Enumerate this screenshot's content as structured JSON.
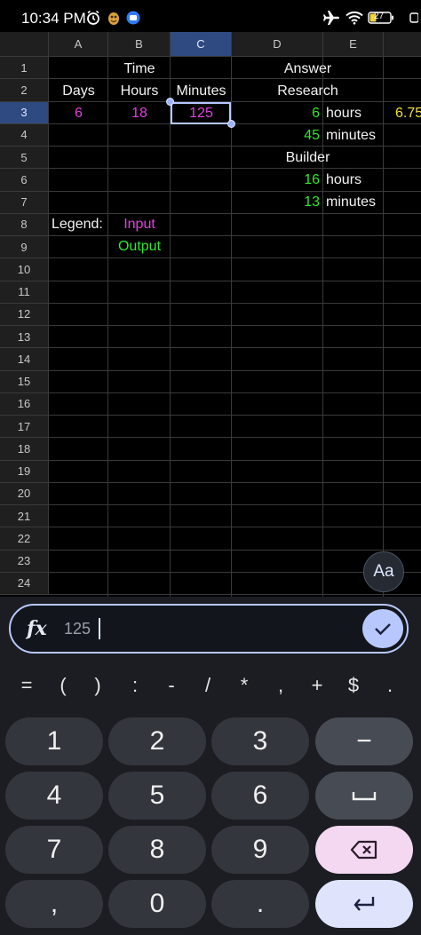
{
  "status": {
    "time": "10:34 PM",
    "battery": "27"
  },
  "sheet": {
    "columns": [
      "A",
      "B",
      "C",
      "D",
      "E"
    ],
    "rows": [
      "1",
      "2",
      "3",
      "4",
      "5",
      "6",
      "7",
      "8",
      "9",
      "10",
      "11",
      "12",
      "13",
      "14",
      "15",
      "16",
      "17",
      "18",
      "19",
      "20",
      "21",
      "22",
      "23",
      "24"
    ],
    "selected_column": "C",
    "selected_row": "3",
    "cells": {
      "time_header": "Time",
      "answer_header": "Answer",
      "days_label": "Days",
      "hours_label": "Hours",
      "minutes_label": "Minutes",
      "research_label": "Research",
      "days_value": "6",
      "hours_value": "18",
      "minutes_value": "125",
      "research_hours_value": "6",
      "research_hours_unit": "hours",
      "research_extra_value": "6.75",
      "research_minutes_value": "45",
      "research_minutes_unit": "minutes",
      "builder_label": "Builder",
      "builder_hours_value": "16",
      "builder_hours_unit": "hours",
      "builder_minutes_value": "13",
      "builder_minutes_unit": "minutes",
      "legend_label": "Legend:",
      "legend_input": "Input",
      "legend_output": "Output"
    }
  },
  "font_button": "Aa",
  "formula_bar": {
    "fx_label": "fx",
    "value": "125"
  },
  "symbols": [
    "=",
    "(",
    ")",
    ":",
    "-",
    "/",
    "*",
    ",",
    "+",
    "$",
    "."
  ],
  "keypad": {
    "k1": "1",
    "k2": "2",
    "k3": "3",
    "minus": "−",
    "k4": "4",
    "k5": "5",
    "k6": "6",
    "k7": "7",
    "k8": "8",
    "k9": "9",
    "comma": ",",
    "k0": "0",
    "dot": "."
  },
  "colors": {
    "input": "#e040e0",
    "output": "#2ee82e",
    "selection": "#b8c8ff"
  }
}
